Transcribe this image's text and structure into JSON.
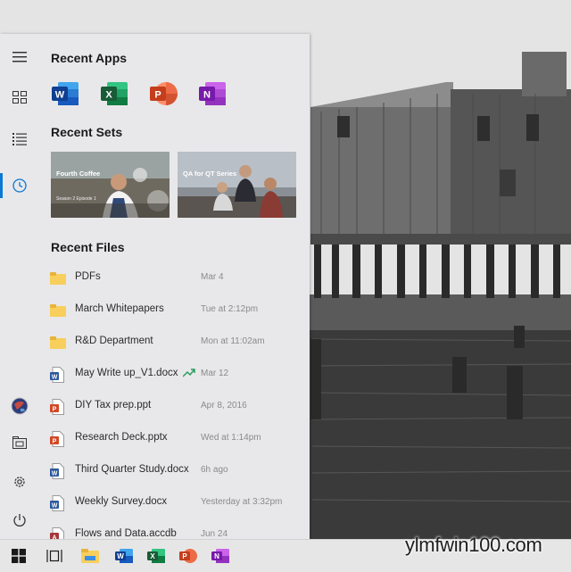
{
  "colors": {
    "accent": "#0a78d4",
    "word": "#2b579a",
    "excel": "#217346",
    "powerpoint": "#d24726",
    "onenote": "#7719aa",
    "folder": "#f8cf5c"
  },
  "menu": {
    "rail_icons": [
      "hamburger-icon",
      "apps-grid-icon",
      "list-icon",
      "clock-icon",
      "globe-icon",
      "media-folder-icon",
      "gear-icon",
      "power-icon"
    ],
    "recent_apps_title": "Recent Apps",
    "recent_apps": [
      {
        "name": "Word",
        "letter": "W",
        "icon": "word-icon"
      },
      {
        "name": "Excel",
        "letter": "X",
        "icon": "excel-icon"
      },
      {
        "name": "PowerPoint",
        "letter": "P",
        "icon": "powerpoint-icon"
      },
      {
        "name": "OneNote",
        "letter": "N",
        "icon": "onenote-icon"
      }
    ],
    "recent_sets_title": "Recent Sets",
    "recent_sets": [
      {
        "title": "Fourth Coffee",
        "subtitle": "Season 2 Episode 1"
      },
      {
        "title": "QA for QT Series",
        "subtitle": ""
      }
    ],
    "recent_files_title": "Recent Files",
    "recent_files": [
      {
        "name": "PDFs",
        "date": "Mar 4",
        "type": "folder"
      },
      {
        "name": "March Whitepapers",
        "date": "Tue at 2:12pm",
        "type": "folder"
      },
      {
        "name": "R&D Department",
        "date": "Mon at 11:02am",
        "type": "folder"
      },
      {
        "name": "May Write up_V1.docx",
        "date": "Mar 12",
        "type": "word",
        "trending": true
      },
      {
        "name": "DIY Tax prep.ppt",
        "date": "Apr 8, 2016",
        "type": "powerpoint"
      },
      {
        "name": "Research Deck.pptx",
        "date": "Wed at 1:14pm",
        "type": "powerpoint"
      },
      {
        "name": "Third Quarter Study.docx",
        "date": "6h ago",
        "type": "word"
      },
      {
        "name": "Weekly Survey.docx",
        "date": "Yesterday at 3:32pm",
        "type": "word"
      },
      {
        "name": "Flows and Data.accdb",
        "date": "Jun 24",
        "type": "access"
      }
    ]
  },
  "taskbar": {
    "icons": [
      "windows-start-icon",
      "task-view-icon",
      "file-explorer-icon",
      "word-icon",
      "excel-icon",
      "powerpoint-icon",
      "onenote-icon"
    ]
  },
  "watermark": "ylmfwin100.com"
}
